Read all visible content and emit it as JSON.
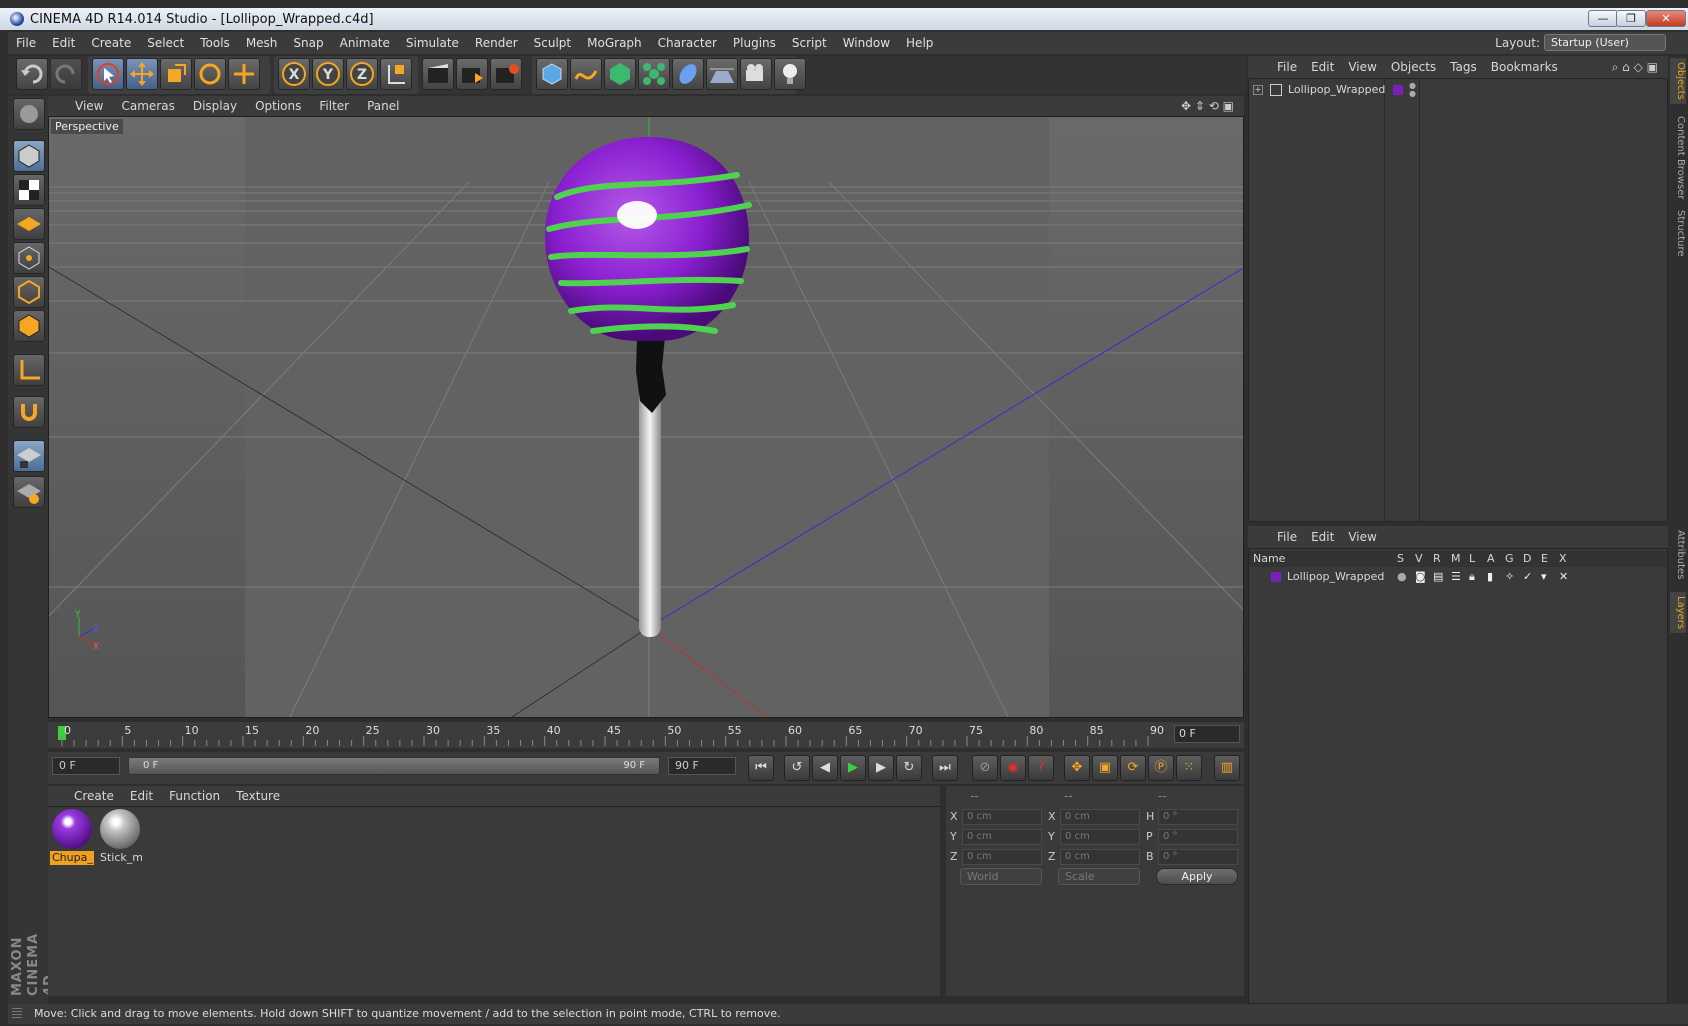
{
  "window": {
    "title": "CINEMA 4D R14.014 Studio - [Lollipop_Wrapped.c4d]",
    "minimize": "—",
    "restore": "❐",
    "close": "✕"
  },
  "menubar": {
    "items": [
      "File",
      "Edit",
      "Create",
      "Select",
      "Tools",
      "Mesh",
      "Snap",
      "Animate",
      "Simulate",
      "Render",
      "Sculpt",
      "MoGraph",
      "Character",
      "Plugins",
      "Script",
      "Window",
      "Help"
    ],
    "layout_label": "Layout:",
    "layout_value": "Startup (User)"
  },
  "viewport": {
    "menu": [
      "View",
      "Cameras",
      "Display",
      "Options",
      "Filter",
      "Panel"
    ],
    "label": "Perspective",
    "axis_y": "Y",
    "axis_z": "Z",
    "axis_x": "X"
  },
  "timeline": {
    "ticks": [
      "0",
      "5",
      "10",
      "15",
      "20",
      "25",
      "30",
      "35",
      "40",
      "45",
      "50",
      "55",
      "60",
      "65",
      "70",
      "75",
      "80",
      "85",
      "90"
    ],
    "current_frame": "0 F"
  },
  "transport": {
    "start_field": "0 F",
    "range_start": "0 F",
    "range_end": "90 F",
    "end_field": "90 F"
  },
  "material_manager": {
    "menu": [
      "Create",
      "Edit",
      "Function",
      "Texture"
    ],
    "materials": [
      {
        "name": "Chupa_",
        "color": "#7a1fb8"
      },
      {
        "name": "Stick_m",
        "color": "#bdbdbd"
      }
    ]
  },
  "coordinates": {
    "headers": [
      "--",
      "--",
      "--"
    ],
    "rows": [
      {
        "l1": "X",
        "v1": "0 cm",
        "l2": "X",
        "v2": "0 cm",
        "l3": "H",
        "v3": "0 °"
      },
      {
        "l1": "Y",
        "v1": "0 cm",
        "l2": "Y",
        "v2": "0 cm",
        "l3": "P",
        "v3": "0 °"
      },
      {
        "l1": "Z",
        "v1": "0 cm",
        "l2": "Z",
        "v2": "0 cm",
        "l3": "B",
        "v3": "0 °"
      }
    ],
    "mode": "World",
    "scale": "Scale",
    "apply": "Apply"
  },
  "object_manager": {
    "menu": [
      "File",
      "Edit",
      "View",
      "Objects",
      "Tags",
      "Bookmarks"
    ],
    "object": "Lollipop_Wrapped"
  },
  "layer_manager": {
    "menu": [
      "File",
      "Edit",
      "View"
    ],
    "columns": [
      "Name",
      "S",
      "V",
      "R",
      "M",
      "L",
      "A",
      "G",
      "D",
      "E",
      "X"
    ],
    "layer": "Lollipop_Wrapped",
    "layer_color": "#7a1fb8"
  },
  "side_tabs": [
    "Objects",
    "Content Browser",
    "Structure",
    "Attributes",
    "Layers"
  ],
  "branding": "MAXON CINEMA 4D",
  "status": "Move: Click and drag to move elements. Hold down SHIFT to quantize movement / add to the selection in point mode, CTRL to remove."
}
